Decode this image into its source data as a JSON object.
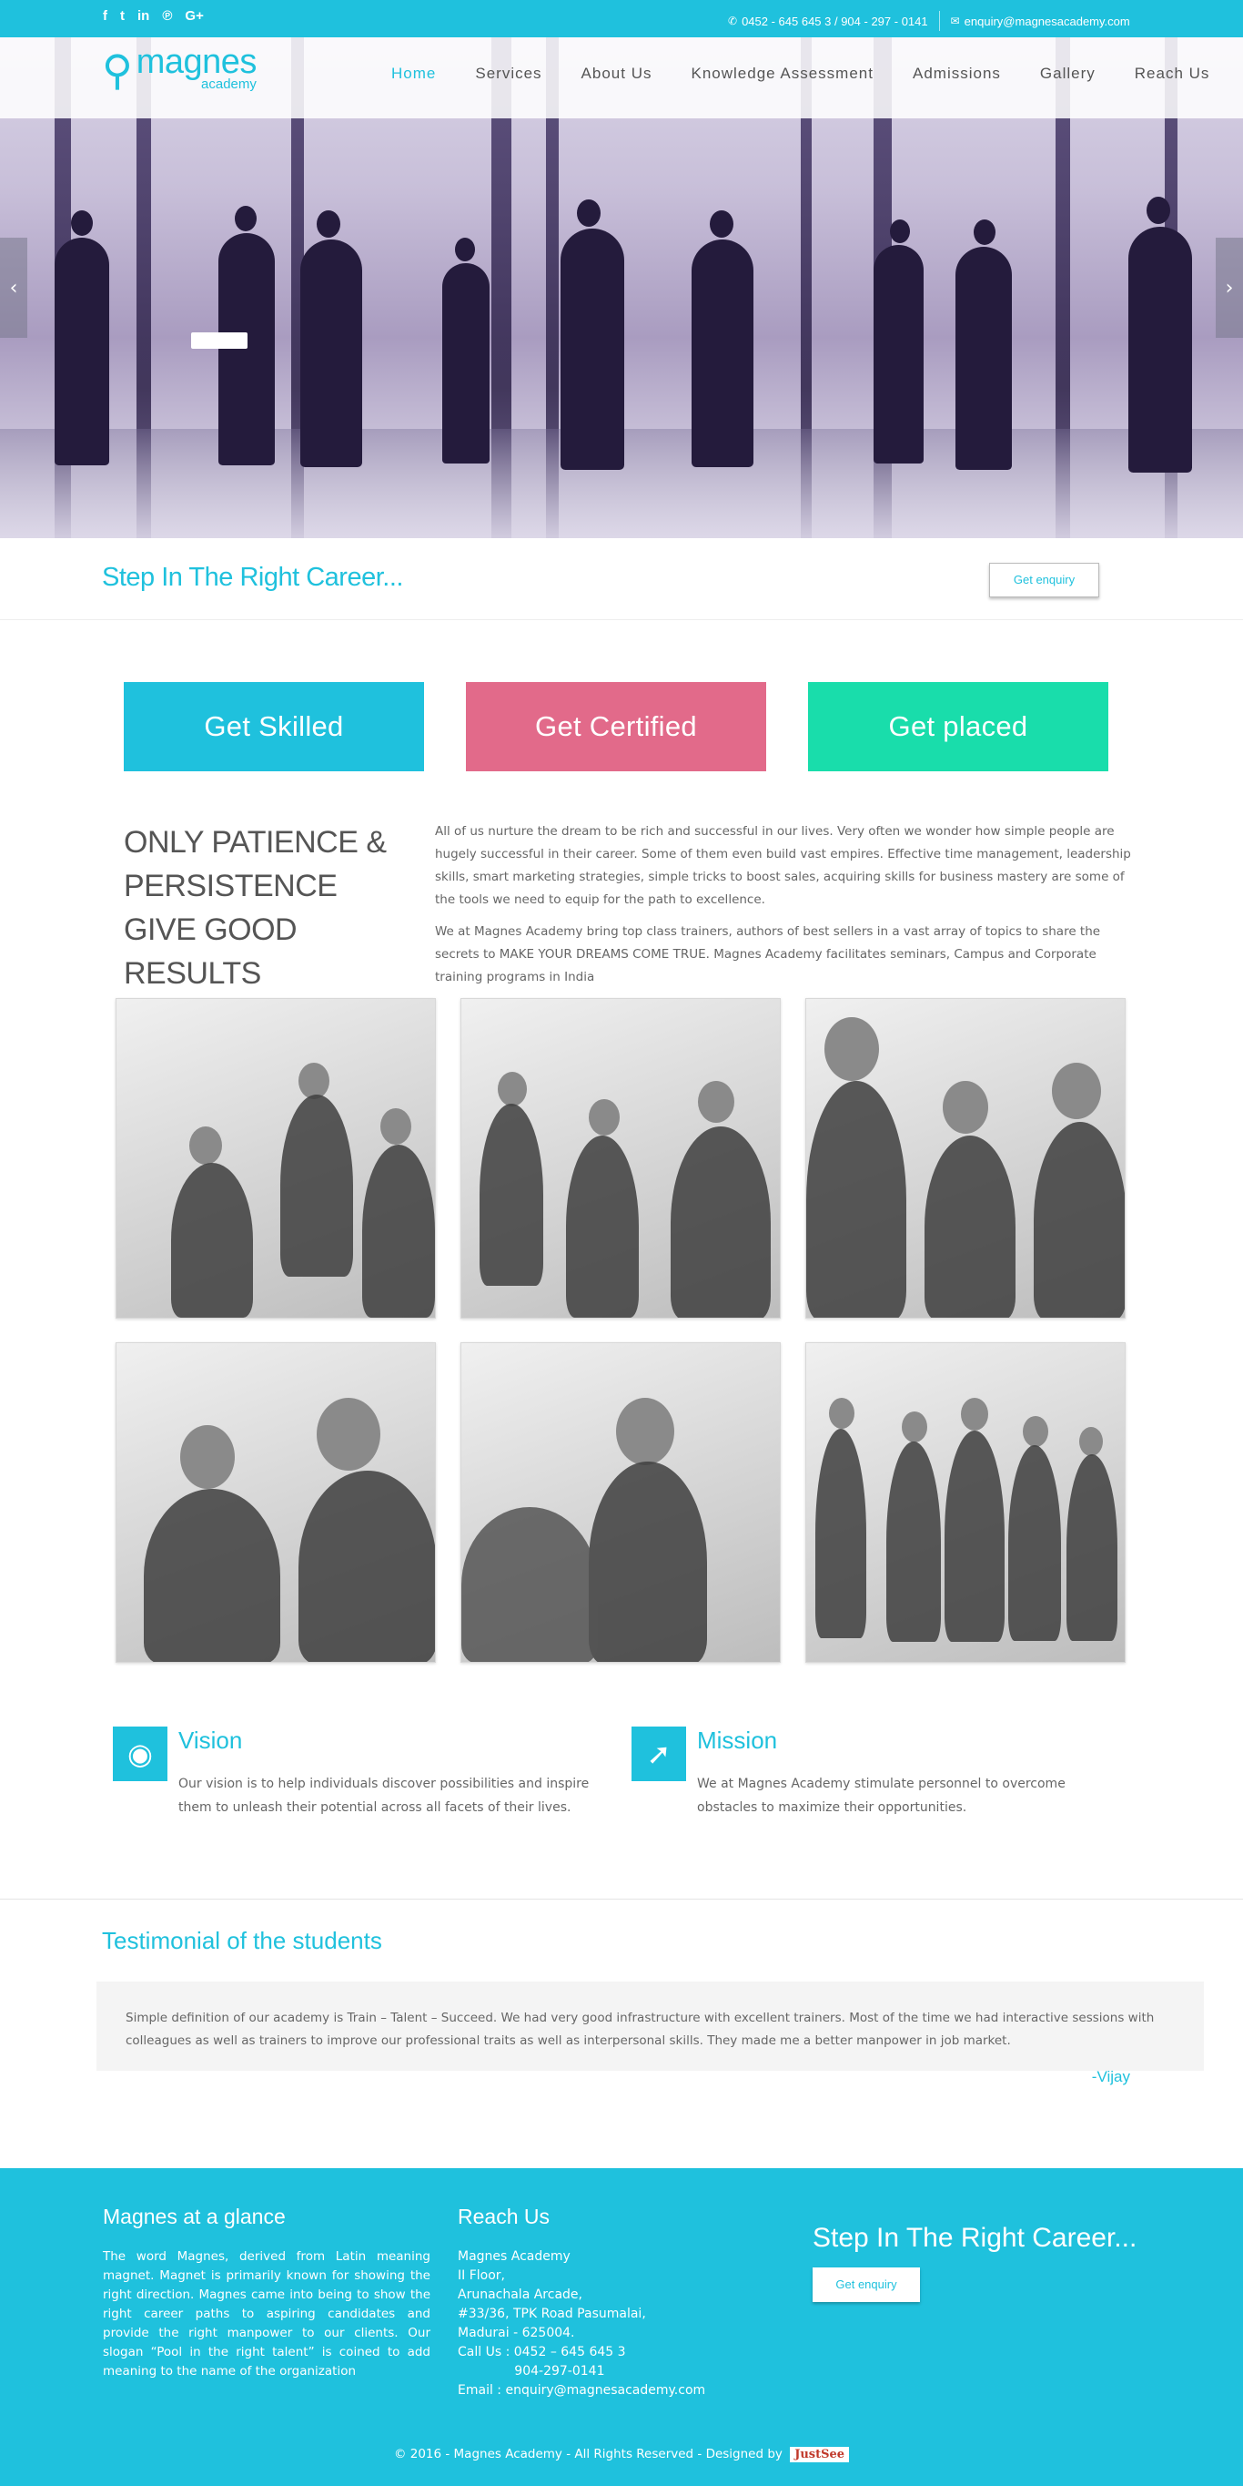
{
  "topbar": {
    "social_icons": [
      "facebook-icon",
      "twitter-icon",
      "linkedin-icon",
      "pinterest-icon",
      "google-plus-icon"
    ],
    "phone": "0452 - 645 645 3 / 904 - 297 - 0141",
    "email": "enquiry@magnesacademy.com"
  },
  "header": {
    "brand": "magnes",
    "brand_sub": "academy",
    "nav": [
      "Home",
      "Services",
      "About Us",
      "Knowledge Assessment",
      "Admissions",
      "Gallery",
      "Reach Us"
    ],
    "active_nav": "Home"
  },
  "hero": {
    "prev_icon": "‹",
    "next_icon": "›"
  },
  "tagline": {
    "title": "Step In The Right Career...",
    "button": "Get enquiry"
  },
  "ctas": [
    {
      "label": "Get Skilled",
      "color": "#1fc1dd"
    },
    {
      "label": "Get Certified",
      "color": "#e26a8a"
    },
    {
      "label": "Get placed",
      "color": "#19ddab"
    }
  ],
  "patience": {
    "heading": "ONLY PATIENCE & PERSISTENCE GIVE GOOD RESULTS",
    "para1": "All of us nurture the dream to be rich and successful in our lives. Very often we wonder how simple people are hugely successful in their career. Some of them even build vast empires. Effective time management, leadership skills, smart marketing strategies, simple tricks to boost sales, acquiring skills for business mastery are some of the tools we need to equip for the path to excellence.",
    "para2": "We at Magnes Academy bring top class trainers, authors of best sellers in a vast array of topics to share the secrets to MAKE YOUR DREAMS COME TRUE. Magnes Academy facilitates seminars, Campus and Corporate training programs in India"
  },
  "vision": {
    "title": "Vision",
    "text": "Our vision is to help individuals discover possibilities and inspire them to unleash their potential across all facets of their lives."
  },
  "mission": {
    "title": "Mission",
    "text": "We at Magnes Academy stimulate personnel to overcome obstacles to maximize their opportunities."
  },
  "testimonial": {
    "heading": "Testimonial of the students",
    "quote": "Simple definition of our academy is Train – Talent – Succeed. We had very good infrastructure with excellent trainers. Most of the time we had interactive sessions with colleagues as well as trainers to improve our professional traits as well as interpersonal skills. They made me a better manpower in job market.",
    "author": "-Vijay"
  },
  "footer": {
    "glance_title": "Magnes at a glance",
    "glance_text": "The word Magnes, derived from Latin meaning magnet. Magnet is primarily known for showing the right direction. Magnes came into being to show the right career paths to aspiring candidates and provide the right manpower to our clients. Our slogan “Pool in the right talent” is coined to add meaning to the name of the organization",
    "reach_title": "Reach Us",
    "address": [
      "Magnes Academy",
      "II Floor,",
      "Arunachala Arcade,",
      "#33/36, TPK Road Pasumalai,",
      "Madurai - 625004.",
      "Call Us : 0452 – 645 645 3",
      "              904-297-0141",
      "Email : enquiry@magnesacademy.com"
    ],
    "step_title": "Step In The Right Career...",
    "step_button": "Get enquiry",
    "copyright": "© 2016 - Magnes Academy - All Rights Reserved - Designed by",
    "designer": "JustSee"
  },
  "colors": {
    "accent": "#1fc1dd",
    "pink": "#e26a8a",
    "green": "#19ddab"
  }
}
